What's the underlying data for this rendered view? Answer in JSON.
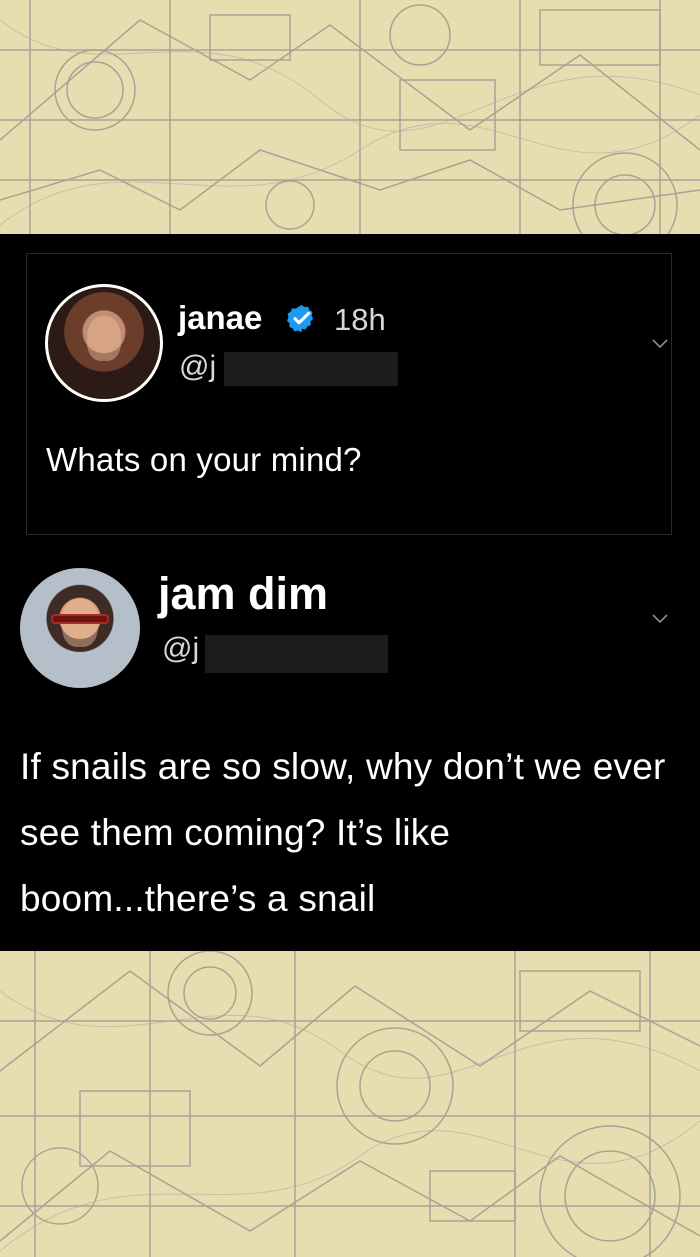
{
  "colors": {
    "background_blueprint": "#e8dcb1",
    "tweet_background": "#000000",
    "text_primary": "#ffffff",
    "text_secondary": "#d8d8d8",
    "verified_badge": "#1d9bf0"
  },
  "tweet_quoted": {
    "author": "janae",
    "time": "18h",
    "handle": "@j",
    "text": "Whats on your mind?",
    "verified_icon": "verified-check-icon",
    "chevron_icon": "chevron-down-icon"
  },
  "tweet_main": {
    "author": "jam dim",
    "handle": "@j",
    "text": "If snails are so slow, why don’t we ever see them coming? It’s like boom...there’s a snail",
    "chevron_icon": "chevron-down-icon"
  }
}
